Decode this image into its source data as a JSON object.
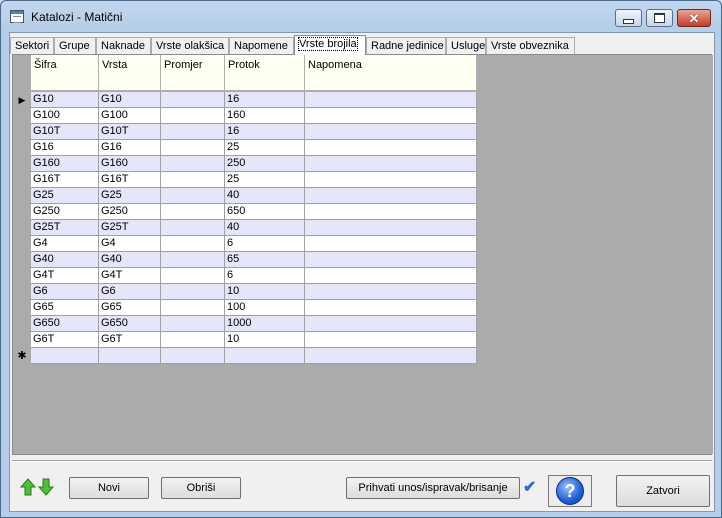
{
  "window": {
    "title": "Katalozi - Matični",
    "minimize_glyph": "",
    "maximize_glyph": "",
    "close_glyph": "✕"
  },
  "tabs": [
    {
      "label": "Sektori"
    },
    {
      "label": "Grupe"
    },
    {
      "label": "Naknade"
    },
    {
      "label": "Vrste olakšica"
    },
    {
      "label": "Napomene"
    },
    {
      "label": "Vrste brojila",
      "active": true
    },
    {
      "label": "Radne jedinice"
    },
    {
      "label": "Usluge"
    },
    {
      "label": "Vrste obveznika"
    }
  ],
  "grid": {
    "columns": [
      "Šifra",
      "Vrsta",
      "Promjer",
      "Protok",
      "Napomena"
    ],
    "rows": [
      [
        "G10",
        "G10",
        "",
        "16",
        ""
      ],
      [
        "G100",
        "G100",
        "",
        "160",
        ""
      ],
      [
        "G10T",
        "G10T",
        "",
        "16",
        ""
      ],
      [
        "G16",
        "G16",
        "",
        "25",
        ""
      ],
      [
        "G160",
        "G160",
        "",
        "250",
        ""
      ],
      [
        "G16T",
        "G16T",
        "",
        "25",
        ""
      ],
      [
        "G25",
        "G25",
        "",
        "40",
        ""
      ],
      [
        "G250",
        "G250",
        "",
        "650",
        ""
      ],
      [
        "G25T",
        "G25T",
        "",
        "40",
        ""
      ],
      [
        "G4",
        "G4",
        "",
        "6",
        ""
      ],
      [
        "G40",
        "G40",
        "",
        "65",
        ""
      ],
      [
        "G4T",
        "G4T",
        "",
        "6",
        ""
      ],
      [
        "G6",
        "G6",
        "",
        "10",
        ""
      ],
      [
        "G65",
        "G65",
        "",
        "100",
        ""
      ],
      [
        "G650",
        "G650",
        "",
        "1000",
        ""
      ],
      [
        "G6T",
        "G6T",
        "",
        "10",
        ""
      ]
    ],
    "current_row_marker": "▶",
    "new_row_marker": "✱",
    "row_colors": {
      "odd": "#e6e6fa",
      "even": "#ffffff"
    }
  },
  "buttons": {
    "new": "Novi",
    "delete": "Obriši",
    "accept": "Prihvati unos/ispravak/brisanje",
    "close": "Zatvori",
    "help": "?",
    "check": "✔"
  },
  "icons": {
    "up": "arrow-up-icon",
    "down": "arrow-down-icon"
  }
}
